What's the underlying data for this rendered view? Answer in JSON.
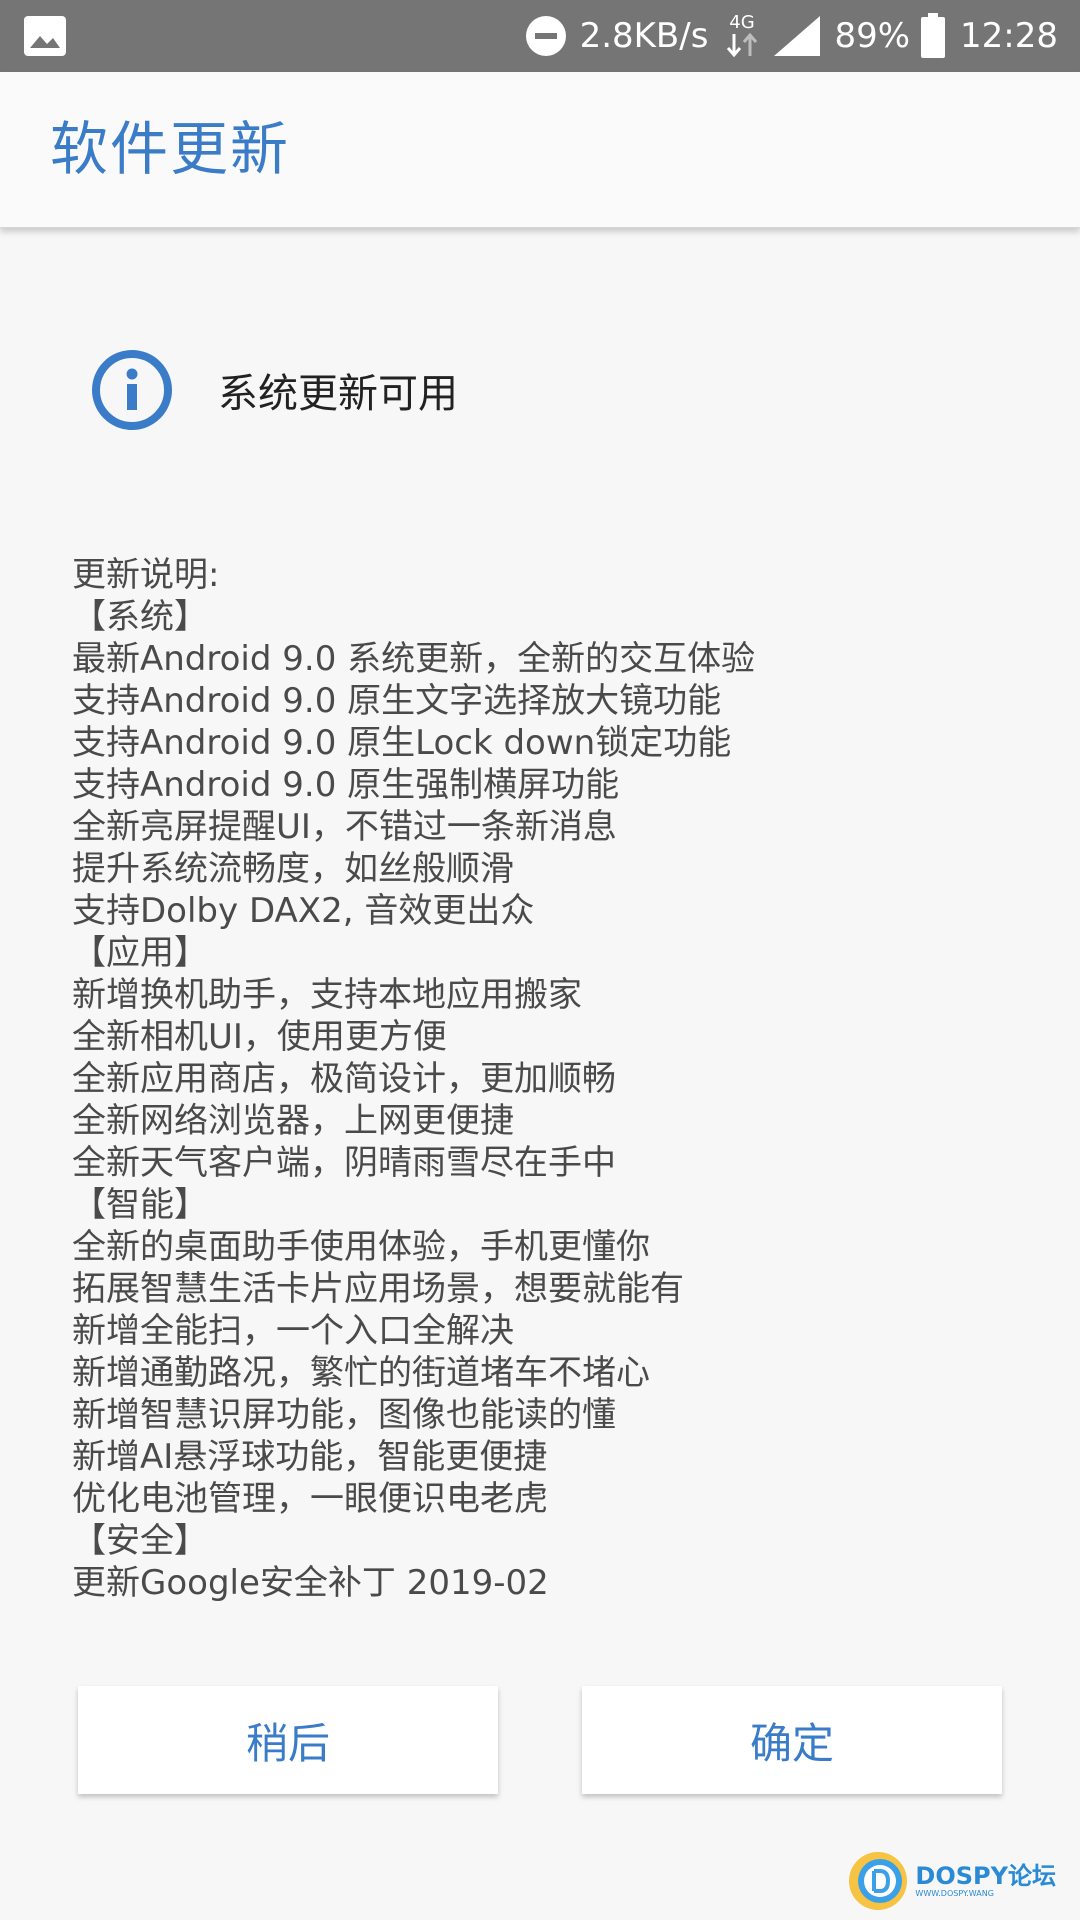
{
  "status_bar": {
    "net_speed": "2.8KB/s",
    "network_type": "4G",
    "battery_percent": "89%",
    "time": "12:28"
  },
  "app_bar": {
    "title": "软件更新"
  },
  "info": {
    "message": "系统更新可用"
  },
  "release_notes": [
    "更新说明:",
    "【系统】",
    "最新Android 9.0 系统更新，全新的交互体验",
    "支持Android 9.0 原生文字选择放大镜功能",
    "支持Android 9.0 原生Lock down锁定功能",
    "支持Android 9.0 原生强制横屏功能",
    "全新亮屏提醒UI，不错过一条新消息",
    "提升系统流畅度，如丝般顺滑",
    "支持Dolby DAX2, 音效更出众",
    "【应用】",
    "新增换机助手，支持本地应用搬家",
    "全新相机UI，使用更方便",
    "全新应用商店，极简设计，更加顺畅",
    "全新网络浏览器，上网更便捷",
    "全新天气客户端，阴晴雨雪尽在手中",
    "【智能】",
    "全新的桌面助手使用体验，手机更懂你",
    "拓展智慧生活卡片应用场景，想要就能有",
    "新增全能扫，一个入口全解决",
    "新增通勤路况，繁忙的街道堵车不堵心",
    "新增智慧识屏功能，图像也能读的懂",
    "新增AI悬浮球功能，智能更便捷",
    "优化电池管理，一眼便识电老虎",
    "【安全】",
    "更新Google安全补丁 2019-02"
  ],
  "buttons": {
    "later": "稍后",
    "confirm": "确定"
  },
  "watermark": {
    "text": "DOSPY论坛",
    "sub": "WWW.DOSPY.WANG"
  },
  "colors": {
    "accent": "#3b7cc8",
    "status_bar": "#757575",
    "background": "#f7f7f7"
  }
}
